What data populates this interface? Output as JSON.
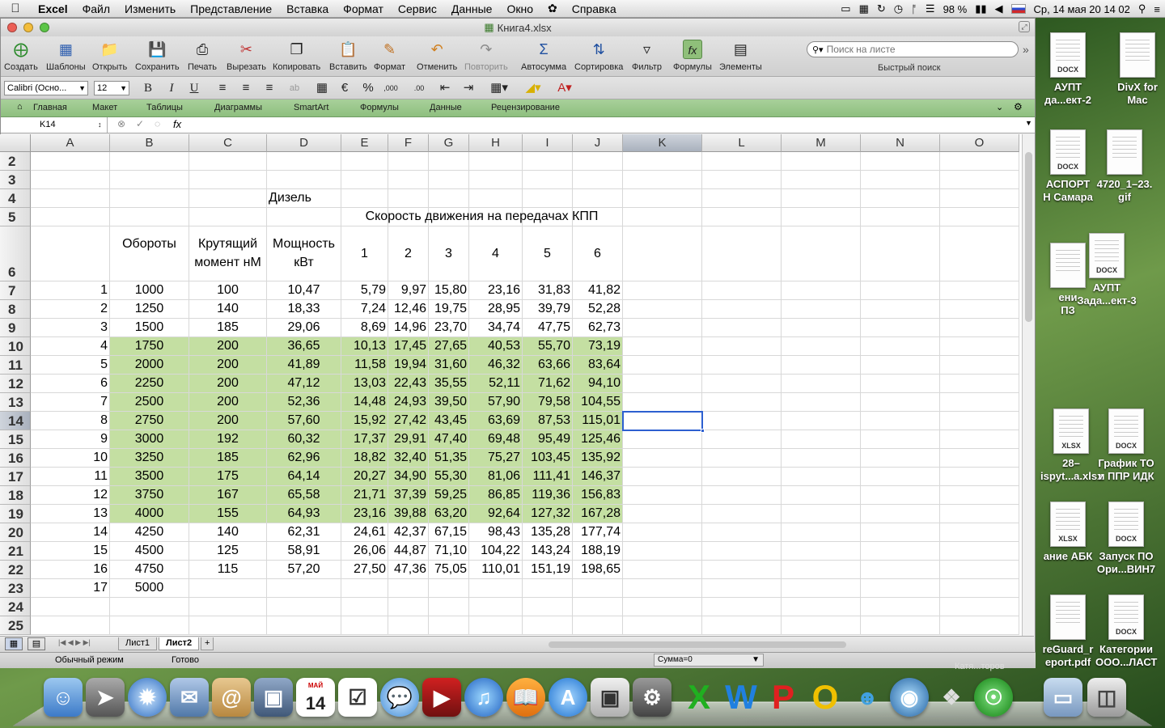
{
  "menubar": {
    "apple": "",
    "app": "Excel",
    "items": [
      "Файл",
      "Изменить",
      "Представление",
      "Вставка",
      "Формат",
      "Сервис",
      "Данные",
      "Окно",
      "Справка"
    ],
    "battery": "98 %",
    "clock": "Ср, 14 мая  20 14 02"
  },
  "window": {
    "title": "Книга4.xlsx"
  },
  "toolbar": {
    "buttons": [
      "Создать",
      "Шаблоны",
      "Открыть",
      "Сохранить",
      "Печать",
      "Вырезать",
      "Копировать",
      "Вставить",
      "Формат",
      "Отменить",
      "Повторить",
      "Автосумма",
      "Сортировка",
      "Фильтр",
      "Формулы",
      "Элементы"
    ],
    "search_placeholder": "Поиск на листе",
    "search_caption": "Быстрый поиск"
  },
  "format": {
    "font": "Calibri (Осно...",
    "size": "12",
    "bold": "B",
    "italic": "I",
    "underline": "U"
  },
  "ribbon": {
    "tabs": [
      "Главная",
      "Макет",
      "Таблицы",
      "Диаграммы",
      "SmartArt",
      "Формулы",
      "Данные",
      "Рецензирование"
    ]
  },
  "formula": {
    "cell_ref": "K14",
    "fx": "fx",
    "value": ""
  },
  "sheet": {
    "columns": [
      "A",
      "B",
      "C",
      "D",
      "E",
      "F",
      "G",
      "H",
      "I",
      "J",
      "K",
      "L",
      "M",
      "N",
      "O"
    ],
    "active_col": "K",
    "active_row": "14",
    "row_numbers": [
      "2",
      "3",
      "4",
      "5",
      "6",
      "7",
      "8",
      "9",
      "10",
      "11",
      "12",
      "13",
      "14",
      "15",
      "16",
      "17",
      "18",
      "19",
      "20",
      "21",
      "22",
      "23",
      "24",
      "25"
    ],
    "title_fuel": "Дизель",
    "title_speed": "Скорость движения на передачах КПП",
    "header_rpm": "Обороты",
    "header_torque": "Крутящий момент нМ",
    "header_power": "Мощность кВт",
    "gears": [
      "1",
      "2",
      "3",
      "4",
      "5",
      "6"
    ],
    "rows": [
      [
        "1",
        "1000",
        "100",
        "10,47",
        "5,79",
        "9,97",
        "15,80",
        "23,16",
        "31,83",
        "41,82"
      ],
      [
        "2",
        "1250",
        "140",
        "18,33",
        "7,24",
        "12,46",
        "19,75",
        "28,95",
        "39,79",
        "52,28"
      ],
      [
        "3",
        "1500",
        "185",
        "29,06",
        "8,69",
        "14,96",
        "23,70",
        "34,74",
        "47,75",
        "62,73"
      ],
      [
        "4",
        "1750",
        "200",
        "36,65",
        "10,13",
        "17,45",
        "27,65",
        "40,53",
        "55,70",
        "73,19"
      ],
      [
        "5",
        "2000",
        "200",
        "41,89",
        "11,58",
        "19,94",
        "31,60",
        "46,32",
        "63,66",
        "83,64"
      ],
      [
        "6",
        "2250",
        "200",
        "47,12",
        "13,03",
        "22,43",
        "35,55",
        "52,11",
        "71,62",
        "94,10"
      ],
      [
        "7",
        "2500",
        "200",
        "52,36",
        "14,48",
        "24,93",
        "39,50",
        "57,90",
        "79,58",
        "104,55"
      ],
      [
        "8",
        "2750",
        "200",
        "57,60",
        "15,92",
        "27,42",
        "43,45",
        "63,69",
        "87,53",
        "115,01"
      ],
      [
        "9",
        "3000",
        "192",
        "60,32",
        "17,37",
        "29,91",
        "47,40",
        "69,48",
        "95,49",
        "125,46"
      ],
      [
        "10",
        "3250",
        "185",
        "62,96",
        "18,82",
        "32,40",
        "51,35",
        "75,27",
        "103,45",
        "135,92"
      ],
      [
        "11",
        "3500",
        "175",
        "64,14",
        "20,27",
        "34,90",
        "55,30",
        "81,06",
        "111,41",
        "146,37"
      ],
      [
        "12",
        "3750",
        "167",
        "65,58",
        "21,71",
        "37,39",
        "59,25",
        "86,85",
        "119,36",
        "156,83"
      ],
      [
        "13",
        "4000",
        "155",
        "64,93",
        "23,16",
        "39,88",
        "63,20",
        "92,64",
        "127,32",
        "167,28"
      ],
      [
        "14",
        "4250",
        "140",
        "62,31",
        "24,61",
        "42,37",
        "67,15",
        "98,43",
        "135,28",
        "177,74"
      ],
      [
        "15",
        "4500",
        "125",
        "58,91",
        "26,06",
        "44,87",
        "71,10",
        "104,22",
        "143,24",
        "188,19"
      ],
      [
        "16",
        "4750",
        "115",
        "57,20",
        "27,50",
        "47,36",
        "75,05",
        "110,01",
        "151,19",
        "198,65"
      ],
      [
        "17",
        "5000",
        "",
        "",
        "",
        "",
        "",
        "",
        "",
        ""
      ]
    ],
    "highlight_color": "#c4dfa2"
  },
  "sheet_tabs": [
    "Лист1",
    "Лист2"
  ],
  "active_sheet": "Лист2",
  "status": {
    "mode": "Обычный режим",
    "state": "Готово",
    "sum": "Сумма=0"
  },
  "desktop_icons": [
    {
      "label": "АУПТ\nда...ект-2",
      "tag": "DOCX"
    },
    {
      "label": "DivX for\nMac",
      "tag": ""
    },
    {
      "label": "АСПОРТ\nН Самара",
      "tag": "DOCX"
    },
    {
      "label": "4720_1–23.\ngif",
      "tag": ""
    },
    {
      "label": "ени\nПЗ",
      "tag": ""
    },
    {
      "label": "АУПТ\nЗада...ект-3",
      "tag": "DOCX"
    },
    {
      "label": "28–\nispyt...a.xlsx",
      "tag": "XLSX"
    },
    {
      "label": "График ТО\nи ППР ИДК",
      "tag": "DOCX"
    },
    {
      "label": "ание АБК",
      "tag": "XLSX"
    },
    {
      "label": "Запуск ПО\nОри...ВИН7",
      "tag": "DOCX"
    },
    {
      "label": "reGuard_r\neport.pdf",
      "tag": ""
    },
    {
      "label": "Категории\nООО...ЛАСТ",
      "tag": "DOCX"
    }
  ],
  "dock_label": "Катя...торов",
  "dock_calendar": {
    "month": "МАЙ",
    "day": "14"
  }
}
